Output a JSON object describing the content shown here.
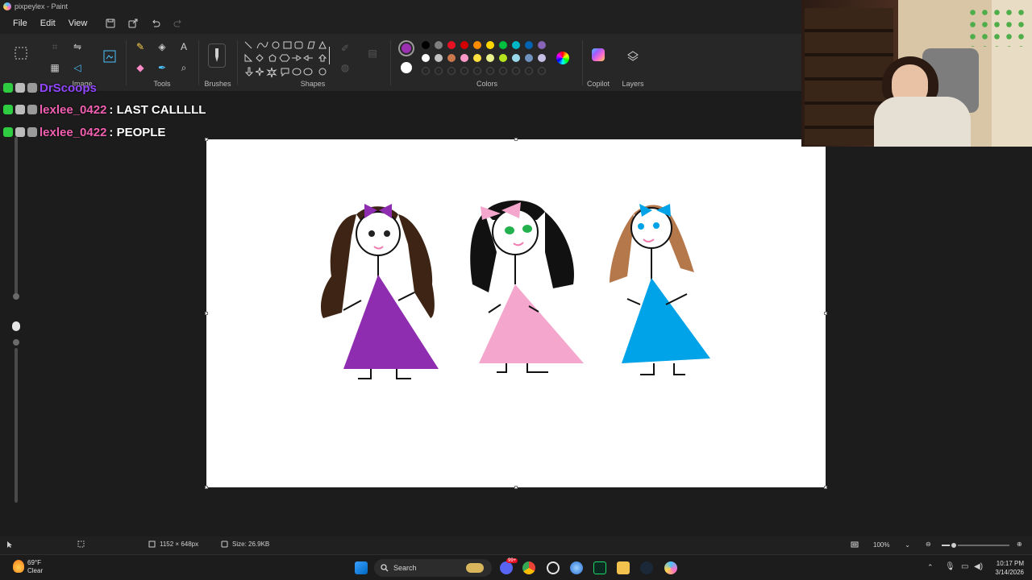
{
  "window": {
    "title": "pixpeylex - Paint"
  },
  "menu": {
    "file": "File",
    "edit": "Edit",
    "view": "View"
  },
  "ribbon": {
    "image_label": "Image",
    "tools_label": "Tools",
    "brushes_label": "Brushes",
    "shapes_label": "Shapes",
    "colors_label": "Colors",
    "copilot_label": "Copilot",
    "layers_label": "Layers",
    "color1": "#9b30b0",
    "color2": "#ffffff",
    "palette": [
      "#000000",
      "#7f7f7f",
      "#e81123",
      "#d40000",
      "#ff8c00",
      "#ffd700",
      "#00c040",
      "#00b7c3",
      "#0063b1",
      "#8764b8",
      "#ffffff",
      "#c3c3c3",
      "#c8784b",
      "#ff9ac8",
      "#ffe040",
      "#e9f08c",
      "#b5e61d",
      "#99d9ea",
      "#7092be",
      "#c8bfe7"
    ]
  },
  "chat": [
    {
      "user": "DrScoops",
      "message": "",
      "user_color": "#9146ff"
    },
    {
      "user": "lexlee_0422",
      "message": ": LAST CALLLLL",
      "user_color": "#f15fb0"
    },
    {
      "user": "lexlee_0422",
      "message": ": PEOPLE",
      "user_color": "#f15fb0"
    }
  ],
  "statusbar": {
    "canvas_size": "1152 × 648px",
    "file_size": "Size: 26.9KB",
    "zoom": "100%",
    "zoom_level": 0.18
  },
  "taskbar": {
    "weather_temp": "69°F",
    "weather_desc": "Clear",
    "search_placeholder": "Search",
    "time": "10:17 PM",
    "date": "3/14/2026",
    "notif_count": "99+"
  }
}
